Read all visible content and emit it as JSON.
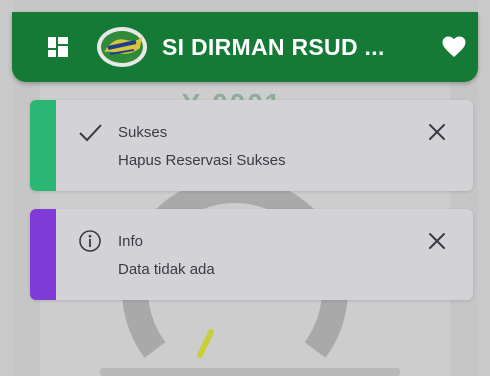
{
  "header": {
    "title": "SI DIRMAN RSUD ...",
    "menu_icon": "dashboard-grid-icon",
    "favorite_icon": "heart-icon",
    "color": "#147a35"
  },
  "background": {
    "queue_number": "Y-0001"
  },
  "toasts": [
    {
      "type": "success",
      "title": "Sukses",
      "message": "Hapus Reservasi Sukses",
      "icon": "check-icon",
      "accent": "#2bb673"
    },
    {
      "type": "info",
      "title": "Info",
      "message": "Data tidak ada",
      "icon": "info-icon",
      "accent": "#7e3bd6"
    }
  ]
}
